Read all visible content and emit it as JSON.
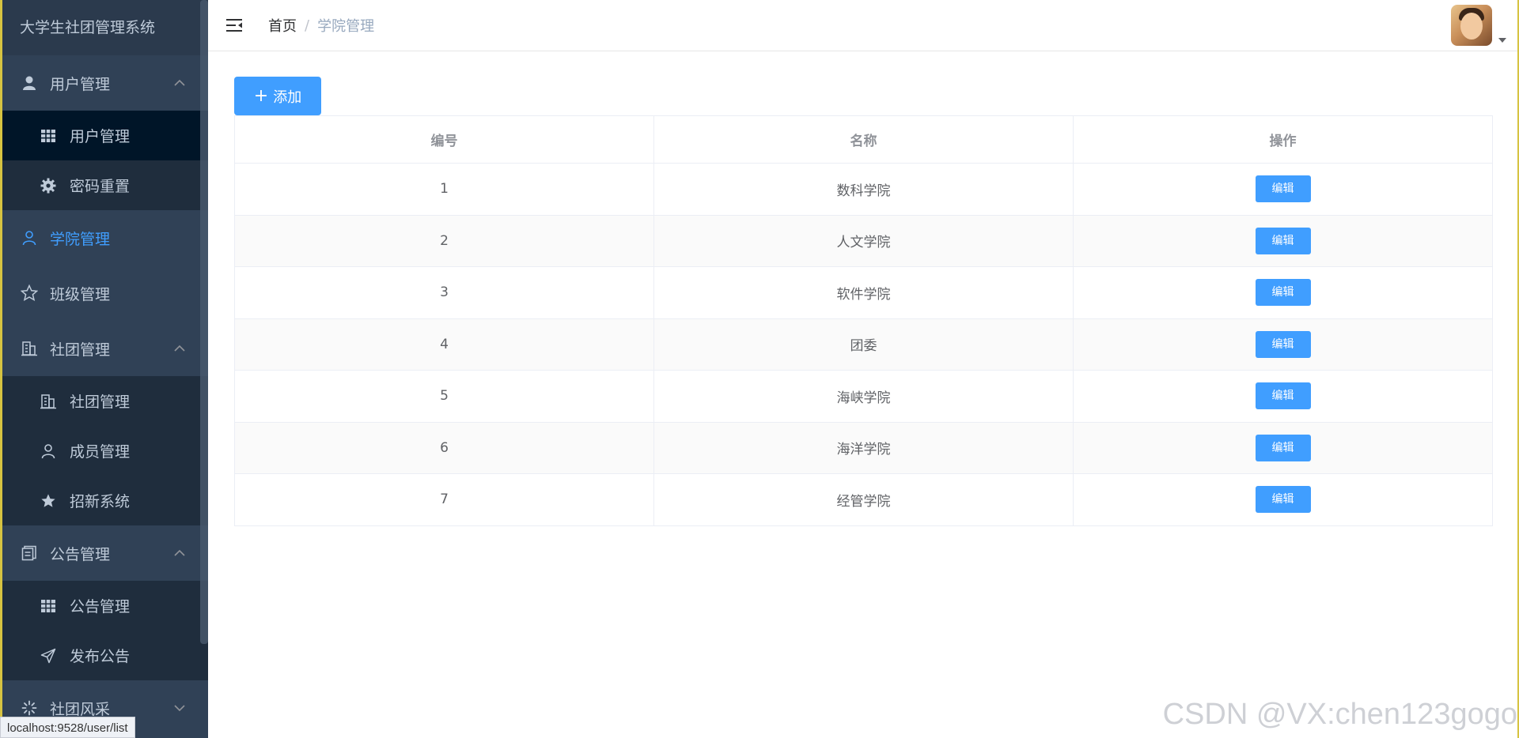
{
  "sidebar": {
    "brand": "大学生社团管理系统",
    "groups": [
      {
        "label": "用户管理",
        "icon": "user-solid-icon",
        "expanded": true,
        "items": [
          {
            "label": "用户管理",
            "icon": "grid-icon",
            "selected": true
          },
          {
            "label": "密码重置",
            "icon": "gear-icon"
          }
        ]
      },
      {
        "label": "学院管理",
        "icon": "user-outline-icon",
        "active": true
      },
      {
        "label": "班级管理",
        "icon": "star-outline-icon"
      },
      {
        "label": "社团管理",
        "icon": "building-icon",
        "expanded": true,
        "items": [
          {
            "label": "社团管理",
            "icon": "building-icon"
          },
          {
            "label": "成员管理",
            "icon": "user-outline-icon"
          },
          {
            "label": "招新系统",
            "icon": "star-solid-icon"
          }
        ]
      },
      {
        "label": "公告管理",
        "icon": "document-icon",
        "expanded": true,
        "items": [
          {
            "label": "公告管理",
            "icon": "grid-icon"
          },
          {
            "label": "发布公告",
            "icon": "send-icon"
          }
        ]
      },
      {
        "label": "社团风采",
        "icon": "loading-icon",
        "expanded": false
      }
    ]
  },
  "header": {
    "breadcrumb_home": "首页",
    "breadcrumb_sep": "/",
    "breadcrumb_current": "学院管理"
  },
  "toolbar": {
    "add_label": "添加"
  },
  "table": {
    "columns": [
      "编号",
      "名称",
      "操作"
    ],
    "rows": [
      {
        "id": "1",
        "name": "数科学院",
        "action": "编辑"
      },
      {
        "id": "2",
        "name": "人文学院",
        "action": "编辑"
      },
      {
        "id": "3",
        "name": "软件学院",
        "action": "编辑"
      },
      {
        "id": "4",
        "name": "团委",
        "action": "编辑"
      },
      {
        "id": "5",
        "name": "海峡学院",
        "action": "编辑"
      },
      {
        "id": "6",
        "name": "海洋学院",
        "action": "编辑"
      },
      {
        "id": "7",
        "name": "经管学院",
        "action": "编辑"
      }
    ]
  },
  "status_bar": {
    "url": "localhost:9528/user/list"
  },
  "watermark": "CSDN @VX:chen123gogo",
  "colors": {
    "sidebar_bg": "#304156",
    "submenu_bg": "#1f2d3d",
    "accent": "#409eff",
    "menu_text": "#bfcbd9"
  }
}
